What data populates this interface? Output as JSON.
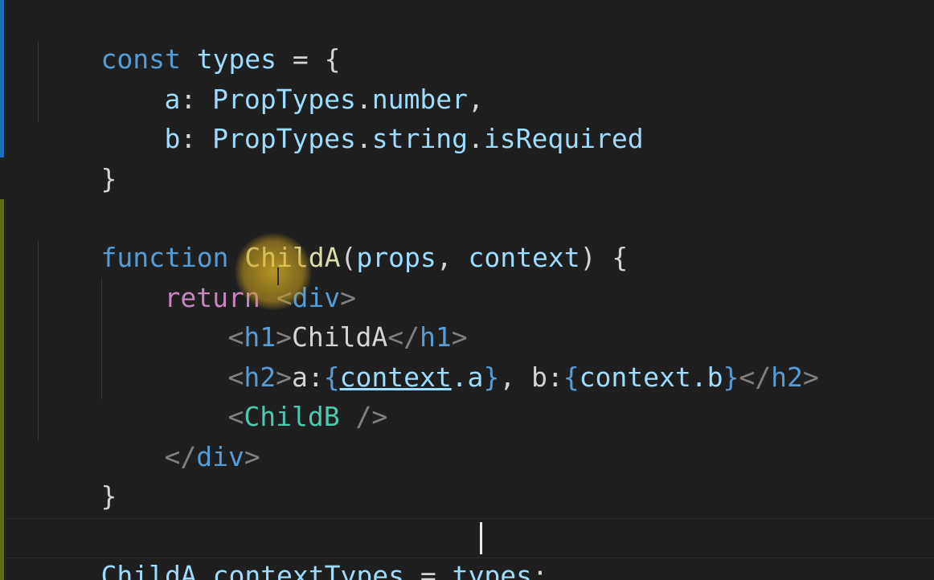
{
  "editor": {
    "lines": [
      {
        "parts": [
          "const",
          " ",
          "types",
          " = ",
          "{"
        ]
      },
      {
        "parts": [
          "a",
          ": ",
          "PropTypes",
          ".",
          "number",
          ","
        ]
      },
      {
        "parts": [
          "b",
          ": ",
          "PropTypes",
          ".",
          "string",
          ".",
          "isRequired"
        ]
      },
      {
        "parts": [
          "}"
        ]
      },
      {
        "parts": [
          "function",
          " ",
          "ChildA",
          "(",
          "props",
          ", ",
          "context",
          ") {"
        ]
      },
      {
        "parts": [
          "return",
          " ",
          "<",
          "div",
          ">"
        ]
      },
      {
        "parts": [
          "<",
          "h1",
          ">",
          "ChildA",
          "</",
          "h1",
          ">"
        ]
      },
      {
        "parts": [
          "<",
          "h2",
          ">",
          "a:",
          "{",
          "context",
          ".a",
          "}",
          ", b:",
          "{",
          "context",
          ".b",
          "}",
          "</",
          "h2",
          ">"
        ]
      },
      {
        "parts": [
          "<",
          "ChildB",
          " />"
        ]
      },
      {
        "parts": [
          "</",
          "div",
          ">"
        ]
      },
      {
        "parts": [
          "}"
        ]
      },
      {
        "parts": [
          "ChildA",
          ".",
          "contextTypes",
          " = ",
          "types",
          ";"
        ]
      }
    ]
  },
  "theme": {
    "background": "#1f1f1f",
    "keyword": "#569cd6",
    "control_keyword": "#c586c0",
    "variable": "#9cdcfe",
    "function": "#dcdcaa",
    "component": "#4ec9b0",
    "tag_bracket": "#808080",
    "modified_bar": "#1b6fb8",
    "added_bar": "#5f6a1c"
  }
}
